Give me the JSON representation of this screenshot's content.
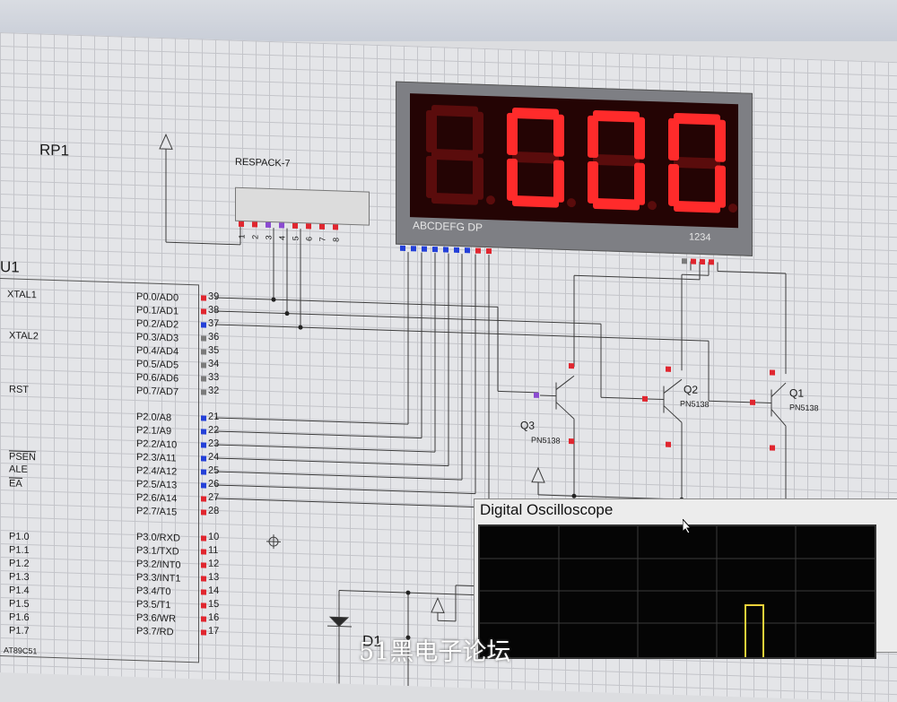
{
  "schematic": {
    "rp1_label": "RP1",
    "respack_label": "RESPACK-7",
    "respack_pins": [
      "1",
      "2",
      "3",
      "4",
      "5",
      "6",
      "7",
      "8"
    ],
    "u1_label": "U1",
    "chip_name": "AT89C51",
    "left_pins": [
      "XTAL1",
      "XTAL2",
      "RST",
      "PSEN",
      "ALE",
      "EA",
      "P1.0",
      "P1.1",
      "P1.2",
      "P1.3",
      "P1.4",
      "P1.5",
      "P1.6",
      "P1.7"
    ],
    "right_pins": [
      "P0.0/AD0",
      "P0.1/AD1",
      "P0.2/AD2",
      "P0.3/AD3",
      "P0.4/AD4",
      "P0.5/AD5",
      "P0.6/AD6",
      "P0.7/AD7",
      "P2.0/A8",
      "P2.1/A9",
      "P2.2/A10",
      "P2.3/A11",
      "P2.4/A12",
      "P2.5/A13",
      "P2.6/A14",
      "P2.7/A15",
      "P3.0/RXD",
      "P3.1/TXD",
      "P3.2/INT0",
      "P3.3/INT1",
      "P3.4/T0",
      "P3.5/T1",
      "P3.6/WR",
      "P3.7/RD"
    ],
    "right_pin_numbers": [
      "39",
      "38",
      "37",
      "36",
      "35",
      "34",
      "33",
      "32",
      "21",
      "22",
      "23",
      "24",
      "25",
      "26",
      "27",
      "28",
      "10",
      "11",
      "12",
      "13",
      "14",
      "15",
      "16",
      "17"
    ],
    "display_segment_label": "ABCDEFG  DP",
    "display_digit_label": "1234",
    "display_digits": [
      "8",
      "0",
      "0",
      "0"
    ],
    "transistors": [
      {
        "name": "Q3",
        "part": "PN5138"
      },
      {
        "name": "Q2",
        "part": "PN5138"
      },
      {
        "name": "Q1",
        "part": "PN5138"
      }
    ],
    "d1_label": "D1"
  },
  "oscilloscope": {
    "title": "Digital Oscilloscope"
  },
  "watermark": "51黑电子论坛",
  "colors": {
    "segment_on": "#ff2b2b",
    "segment_off": "#5a0c0c",
    "pin_high": "#e0262f",
    "pin_low": "#2440d8"
  }
}
